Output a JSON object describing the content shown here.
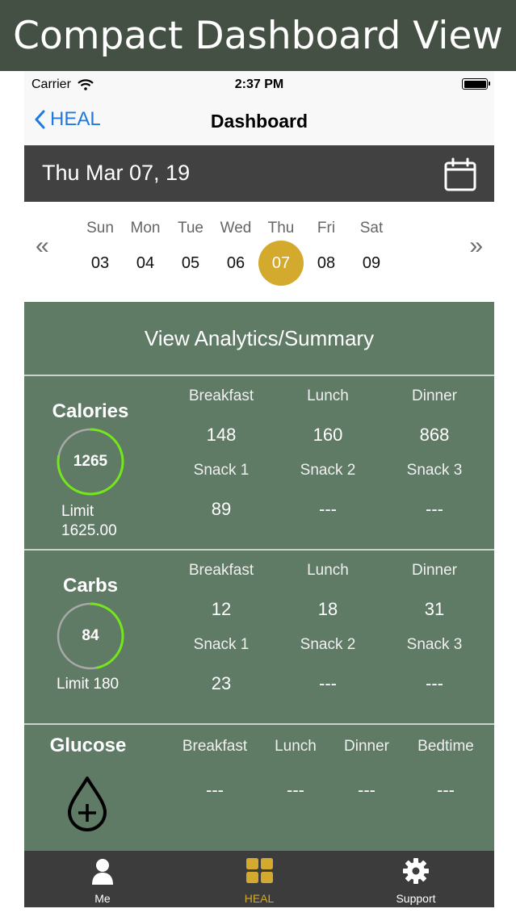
{
  "banner": {
    "title": "Compact Dashboard View"
  },
  "status": {
    "carrier": "Carrier",
    "time": "2:37 PM"
  },
  "nav": {
    "back_label": "HEAL",
    "title": "Dashboard"
  },
  "date_bar": {
    "date": "Thu Mar 07, 19",
    "icon": "calendar-icon"
  },
  "week": {
    "days": [
      {
        "name": "Sun",
        "num": "03"
      },
      {
        "name": "Mon",
        "num": "04"
      },
      {
        "name": "Tue",
        "num": "05"
      },
      {
        "name": "Wed",
        "num": "06"
      },
      {
        "name": "Thu",
        "num": "07"
      },
      {
        "name": "Fri",
        "num": "08"
      },
      {
        "name": "Sat",
        "num": "09"
      }
    ],
    "selected_index": 4,
    "prev_arrow": "«",
    "next_arrow": "»",
    "selected_color": "#d4aa2e"
  },
  "analytics_label": "View Analytics/Summary",
  "calories": {
    "title": "Calories",
    "value": "1265",
    "limit_label": "Limit",
    "limit_value": "1625.00",
    "progress": 0.78,
    "ring_color": "#74e61c",
    "meals": [
      {
        "label": "Breakfast",
        "value": "148"
      },
      {
        "label": "Lunch",
        "value": "160"
      },
      {
        "label": "Dinner",
        "value": "868"
      },
      {
        "label": "Snack 1",
        "value": "89"
      },
      {
        "label": "Snack 2",
        "value": "---"
      },
      {
        "label": "Snack 3",
        "value": "---"
      }
    ]
  },
  "carbs": {
    "title": "Carbs",
    "value": "84",
    "limit": "Limit 180",
    "progress": 0.47,
    "ring_color": "#74e61c",
    "meals": [
      {
        "label": "Breakfast",
        "value": "12"
      },
      {
        "label": "Lunch",
        "value": "18"
      },
      {
        "label": "Dinner",
        "value": "31"
      },
      {
        "label": "Snack 1",
        "value": "23"
      },
      {
        "label": "Snack 2",
        "value": "---"
      },
      {
        "label": "Snack 3",
        "value": "---"
      }
    ]
  },
  "glucose": {
    "title": "Glucose",
    "icon": "drop-plus-icon",
    "readings": [
      {
        "label": "Breakfast",
        "value": "---"
      },
      {
        "label": "Lunch",
        "value": "---"
      },
      {
        "label": "Dinner",
        "value": "---"
      },
      {
        "label": "Bedtime",
        "value": "---"
      }
    ]
  },
  "tabs": [
    {
      "label": "Me",
      "icon": "person-icon"
    },
    {
      "label": "HEAL",
      "icon": "grid-icon"
    },
    {
      "label": "Support",
      "icon": "gear-icon"
    }
  ],
  "active_tab": 1,
  "colors": {
    "accent": "#d4aa2e",
    "panel": "#5f7a65",
    "date_bar": "#414141",
    "tab_bar": "#3c3c3c",
    "link": "#1f7ae0"
  }
}
